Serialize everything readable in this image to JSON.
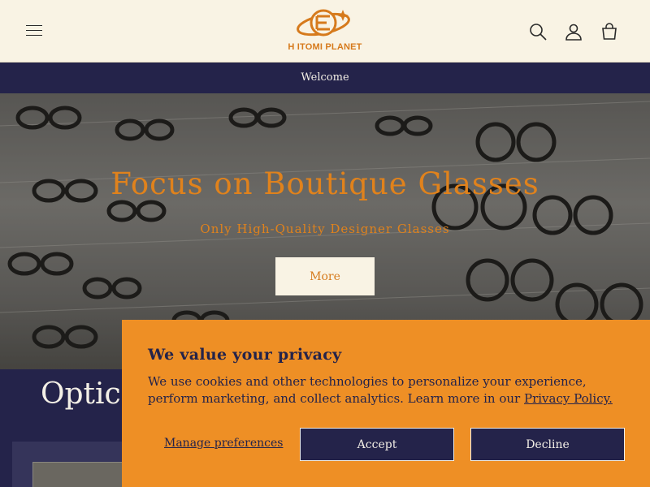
{
  "header": {
    "logo_text": "H ITOMI PLANET",
    "menu_icon": "hamburger-menu-icon",
    "search_icon": "search-icon",
    "account_icon": "user-icon",
    "cart_icon": "cart-icon"
  },
  "announcement": {
    "text": "Welcome"
  },
  "hero": {
    "title": "Focus on Boutique Glasses",
    "subtitle": "Only High-Quality Designer Glasses",
    "button_label": "More"
  },
  "section": {
    "title_visible": "Optica"
  },
  "cookie": {
    "title": "We value your privacy",
    "body": "We use cookies and other technologies to personalize your experience, perform marketing, and collect analytics. Learn more in our ",
    "link_label": "Privacy Policy.",
    "manage_label": "Manage preferences",
    "accept_label": "Accept",
    "decline_label": "Decline"
  },
  "colors": {
    "accent": "#e0821c",
    "navy": "#24234a",
    "cream": "#f9f3e4",
    "banner": "#ee8f25"
  }
}
